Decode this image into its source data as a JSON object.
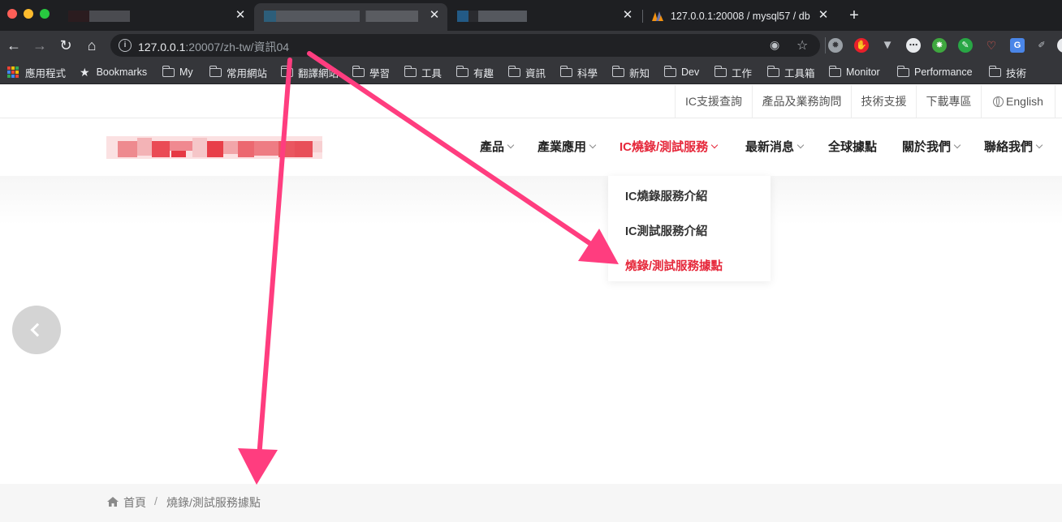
{
  "browser": {
    "tabs": [
      {
        "title": "",
        "active": false
      },
      {
        "title": "",
        "active": true
      },
      {
        "title": "",
        "active": false
      },
      {
        "title": "127.0.0.1:20008 / mysql57 / db",
        "active": false
      }
    ],
    "address": {
      "host": "127.0.0.1",
      "rest": ":20007/zh-tw/資訊04"
    },
    "bookmarks": [
      {
        "label": "應用程式",
        "icon": "apps-grid-icon"
      },
      {
        "label": "Bookmarks",
        "icon": "star-icon"
      },
      {
        "label": "My",
        "icon": "folder-icon"
      },
      {
        "label": "常用網站",
        "icon": "folder-icon"
      },
      {
        "label": "翻譯網站",
        "icon": "folder-icon"
      },
      {
        "label": "學習",
        "icon": "folder-icon"
      },
      {
        "label": "工具",
        "icon": "folder-icon"
      },
      {
        "label": "有趣",
        "icon": "folder-icon"
      },
      {
        "label": "資訊",
        "icon": "folder-icon"
      },
      {
        "label": "科學",
        "icon": "folder-icon"
      },
      {
        "label": "新知",
        "icon": "folder-icon"
      },
      {
        "label": "Dev",
        "icon": "folder-icon"
      },
      {
        "label": "工作",
        "icon": "folder-icon"
      },
      {
        "label": "工具箱",
        "icon": "folder-icon"
      },
      {
        "label": "Monitor",
        "icon": "folder-icon"
      },
      {
        "label": "Performance",
        "icon": "folder-icon"
      },
      {
        "label": "技術",
        "icon": "folder-icon"
      }
    ]
  },
  "site": {
    "utility_links": [
      "IC支援查詢",
      "產品及業務詢問",
      "技術支援",
      "下載專區",
      "English"
    ],
    "nav": [
      {
        "label": "產品",
        "has_dropdown": true
      },
      {
        "label": "產業應用",
        "has_dropdown": true
      },
      {
        "label": "IC燒錄/測試服務",
        "has_dropdown": true,
        "active": true
      },
      {
        "label": "最新消息",
        "has_dropdown": true
      },
      {
        "label": "全球據點",
        "has_dropdown": false
      },
      {
        "label": "關於我們",
        "has_dropdown": true
      },
      {
        "label": "聯絡我們",
        "has_dropdown": true
      }
    ],
    "dropdown": [
      "IC燒錄服務介紹",
      "IC測試服務介紹",
      "燒錄/測試服務據點"
    ],
    "breadcrumb": {
      "home": "首頁",
      "separator": "/",
      "current": "燒錄/測試服務據點"
    }
  },
  "colors": {
    "accent": "#e6283b",
    "annotation": "#ff3d7f",
    "browser_dark": "#35363a"
  }
}
